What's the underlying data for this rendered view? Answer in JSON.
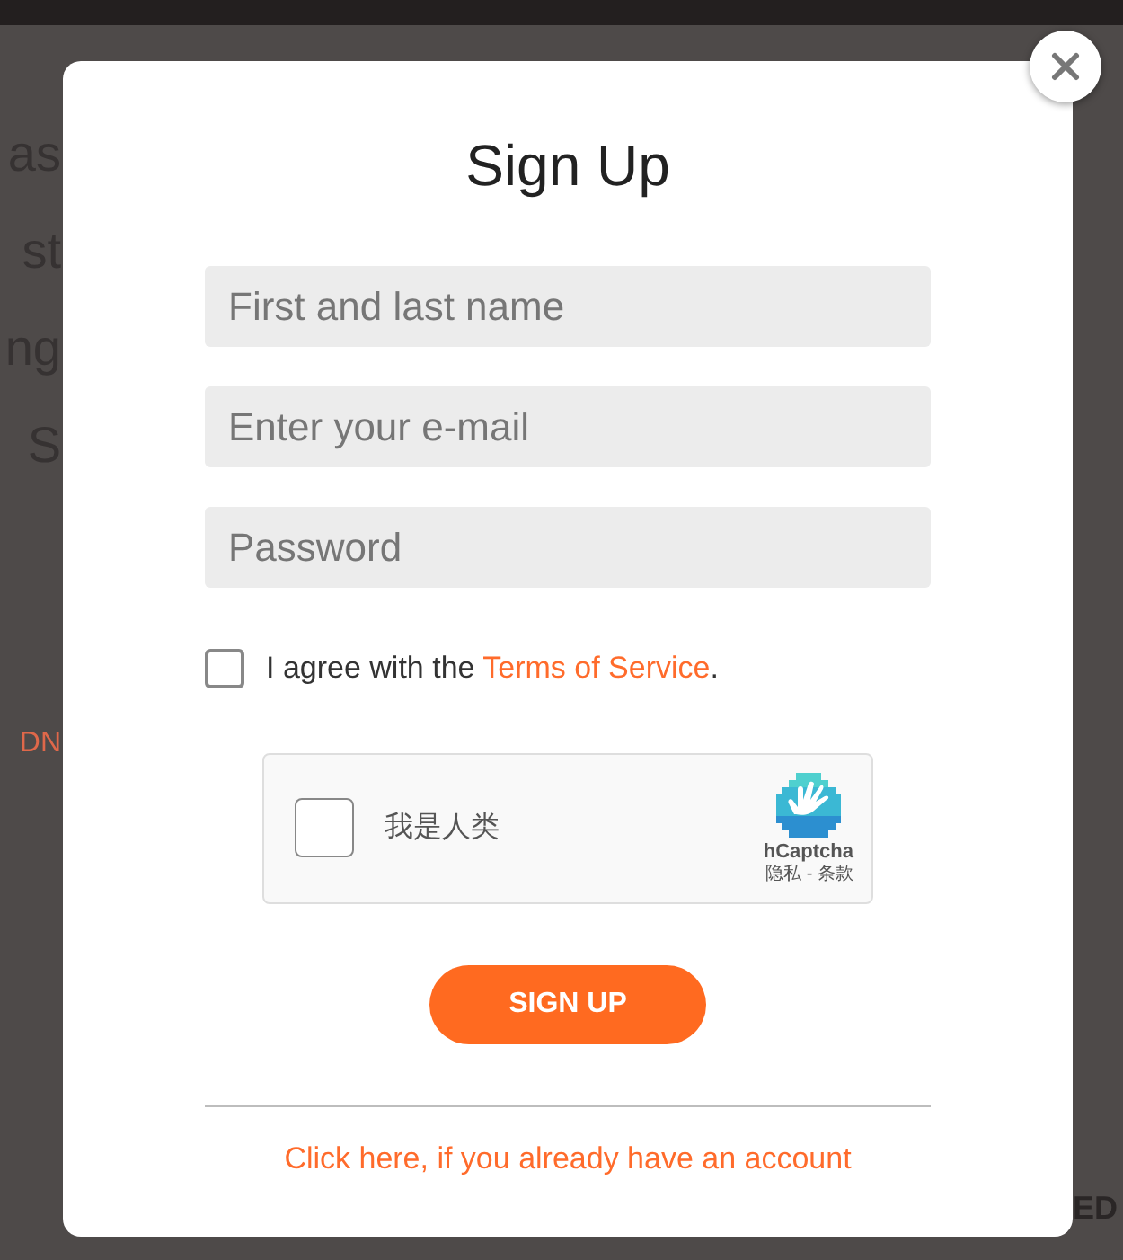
{
  "background": {
    "heading_fragments": [
      "as",
      "st",
      "ng",
      "S"
    ],
    "link_fragment": "DN",
    "corner_fragment": "ED"
  },
  "modal": {
    "title": "Sign Up",
    "fields": [
      {
        "placeholder": "First and last name"
      },
      {
        "placeholder": "Enter your e-mail"
      },
      {
        "placeholder": "Password"
      }
    ],
    "agree": {
      "checked": false,
      "text": "I agree with the ",
      "link": "Terms of Service",
      "end": "."
    },
    "captcha": {
      "checked": false,
      "label": "我是人类",
      "brand": "hCaptcha",
      "links": "隐私 - 条款"
    },
    "submit": "SIGN UP",
    "login_link": "Click here, if you already have an account"
  }
}
